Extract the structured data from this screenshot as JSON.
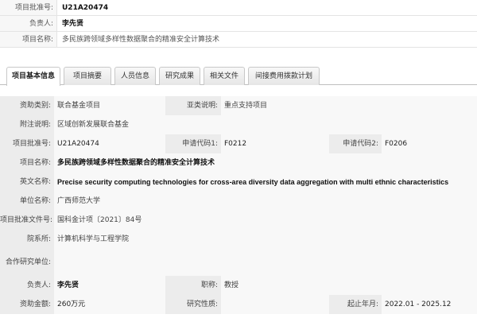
{
  "header": {
    "rows": [
      {
        "label": "项目批准号:",
        "value": "U21A20474"
      },
      {
        "label": "负责人:",
        "value": "李先贤"
      },
      {
        "label": "项目名称:",
        "value": "多民族跨领域多样性数据聚合的精准安全计算技术"
      }
    ]
  },
  "tabs": [
    {
      "label": "项目基本信息",
      "active": true
    },
    {
      "label": "项目摘要",
      "active": false
    },
    {
      "label": "人员信息",
      "active": false
    },
    {
      "label": "研究成果",
      "active": false
    },
    {
      "label": "相关文件",
      "active": false
    },
    {
      "label": "间接费用拨款计划",
      "active": false
    }
  ],
  "details": {
    "funding_type_label": "资助类别:",
    "funding_type": "联合基金项目",
    "subsidy_label": "亚类说明:",
    "subsidy": "重点支持项目",
    "note_label": "附注说明:",
    "note": "区域创新发展联合基金",
    "approval_no_label": "项目批准号:",
    "approval_no": "U21A20474",
    "code1_label": "申请代码1:",
    "code1": "F0212",
    "code2_label": "申请代码2:",
    "code2": "F0206",
    "project_name_label": "项目名称:",
    "project_name": "多民族跨领域多样性数据聚合的精准安全计算技术",
    "english_name_label": "英文名称:",
    "english_name": "Precise security computing technologies for cross-area diversity data aggregation with multi ethnic characteristics",
    "unit_label": "单位名称:",
    "unit": "广西师范大学",
    "approval_doc_label": "项目批准文件号:",
    "approval_doc": "国科金计项〔2021〕84号",
    "department_label": "院系所:",
    "department": "计算机科学与工程学院",
    "coop_unit_label": "合作研究单位:",
    "coop_unit": "",
    "leader_label": "负责人:",
    "leader": "李先贤",
    "title_label": "职称:",
    "title_value": "教授",
    "amount_label": "资助金额:",
    "amount": "260万元",
    "research_nature_label": "研究性质:",
    "research_nature": "",
    "period_label": "起止年月:",
    "period": "2022.01 - 2025.12"
  }
}
